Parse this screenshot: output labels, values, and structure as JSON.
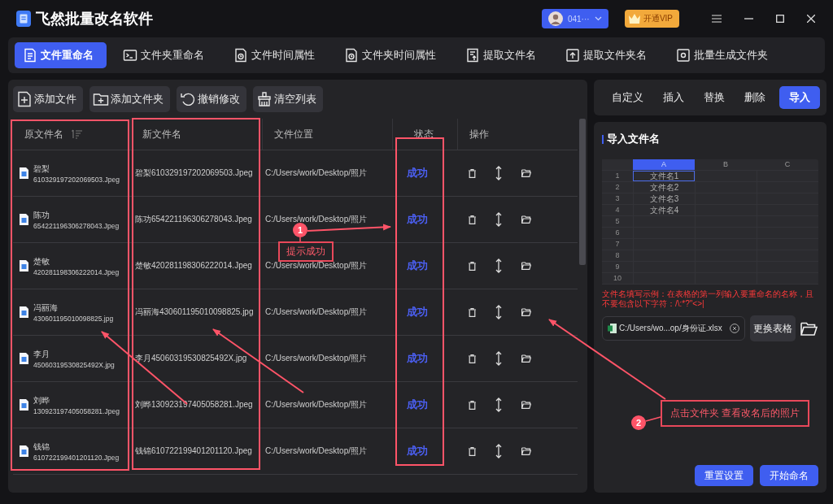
{
  "app": {
    "title": "飞然批量改名软件"
  },
  "account": {
    "name": "041···"
  },
  "vip_button": "开通VIP",
  "nav_tabs": [
    {
      "label": "文件重命名",
      "selected": true
    },
    {
      "label": "文件夹重命名",
      "selected": false
    },
    {
      "label": "文件时间属性",
      "selected": false
    },
    {
      "label": "文件夹时间属性",
      "selected": false
    },
    {
      "label": "提取文件名",
      "selected": false
    },
    {
      "label": "提取文件夹名",
      "selected": false
    },
    {
      "label": "批量生成文件夹",
      "selected": false
    }
  ],
  "toolbar": [
    "添加文件",
    "添加文件夹",
    "撤销修改",
    "清空列表"
  ],
  "table": {
    "columns": [
      "原文件名",
      "新文件名",
      "文件位置",
      "状态",
      "操作"
    ],
    "rows": [
      {
        "original_name": "碧梨",
        "original_number": "610329197202069503.Jpeg",
        "new_name": "碧梨610329197202069503.Jpeg",
        "location": "C:/Users/work/Desktop/照片",
        "status": "成功"
      },
      {
        "original_name": "陈功",
        "original_number": "654221196306278043.Jpeg",
        "new_name": "陈功654221196306278043.Jpeg",
        "location": "C:/Users/work/Desktop/照片",
        "status": "成功"
      },
      {
        "original_name": "楚敏",
        "original_number": "420281198306222014.Jpeg",
        "new_name": "楚敏420281198306222014.Jpeg",
        "location": "C:/Users/work/Desktop/照片",
        "status": "成功"
      },
      {
        "original_name": "冯丽海",
        "original_number": "430601195010098825.jpg",
        "new_name": "冯丽海430601195010098825.jpg",
        "location": "C:/Users/work/Desktop/照片",
        "status": "成功"
      },
      {
        "original_name": "李月",
        "original_number": "45060319530825492X.jpg",
        "new_name": "李月45060319530825492X.jpg",
        "location": "C:/Users/work/Desktop/照片",
        "status": "成功"
      },
      {
        "original_name": "刘晔",
        "original_number": "130923197405058281.Jpeg",
        "new_name": "刘晔130923197405058281.Jpeg",
        "location": "C:/Users/work/Desktop/照片",
        "status": "成功"
      },
      {
        "original_name": "钱锦",
        "original_number": "610722199401201120.Jpeg",
        "new_name": "钱锦610722199401201120.Jpeg",
        "location": "C:/Users/work/Desktop/照片",
        "status": "成功"
      }
    ]
  },
  "side_tabs": [
    {
      "label": "自定义",
      "selected": false
    },
    {
      "label": "插入",
      "selected": false
    },
    {
      "label": "替换",
      "selected": false
    },
    {
      "label": "删除",
      "selected": false
    },
    {
      "label": "导入",
      "selected": true
    }
  ],
  "import_panel": {
    "title": "导入文件名",
    "sheet": {
      "columns": [
        {
          "label": "A",
          "selected": true
        },
        {
          "label": "B",
          "selected": false
        },
        {
          "label": "C",
          "selected": false
        }
      ],
      "rows": [
        {
          "label": "1",
          "value": "文件名1",
          "selected": true
        },
        {
          "label": "2",
          "value": "文件名2",
          "selected": false
        },
        {
          "label": "3",
          "value": "文件名3",
          "selected": false
        },
        {
          "label": "4",
          "value": "文件名4",
          "selected": false
        },
        {
          "label": "5",
          "selected": false
        },
        {
          "label": "6",
          "selected": false
        },
        {
          "label": "7",
          "selected": false
        },
        {
          "label": "8",
          "selected": false
        },
        {
          "label": "9",
          "selected": false
        },
        {
          "label": "10",
          "selected": false
        }
      ]
    },
    "hint": "文件名填写示例：在表格的第一列输入要重命名的名称，且不要包含以下字符：/\\:*?\"<>|",
    "file_path": "C:/Users/wo...op/身份证.xlsx",
    "change_button": "更换表格"
  },
  "buttons": [
    "重置设置",
    "开始命名"
  ],
  "annotations": [
    {
      "number": "1",
      "text": "提示成功"
    },
    {
      "number": "2",
      "text": "点击文件夹 查看改名后的照片"
    }
  ]
}
